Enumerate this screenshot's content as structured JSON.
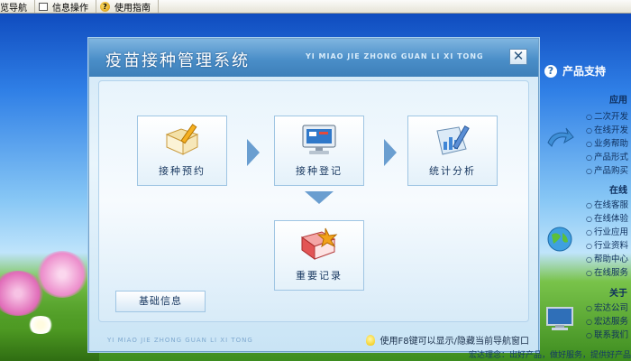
{
  "menubar": {
    "items": [
      {
        "label": "览导航",
        "icon": "none"
      },
      {
        "label": "信息操作",
        "icon": "page-icon"
      },
      {
        "label": "使用指南",
        "icon": "help-icon"
      }
    ]
  },
  "dialog": {
    "title": "疫苗接种管理系统",
    "title_pinyin": "YI MIAO JIE ZHONG GUAN LI XI TONG",
    "close_label": "✕",
    "features": [
      {
        "label": "接种预约",
        "icon": "notebook-pencil-icon"
      },
      {
        "label": "接种登记",
        "icon": "computer-monitor-icon"
      },
      {
        "label": "统计分析",
        "icon": "chart-pen-icon"
      },
      {
        "label": "重要记录",
        "icon": "book-leaf-icon"
      }
    ],
    "basic_info_label": "基础信息",
    "footer_pinyin": "YI MIAO JIE ZHONG GUAN LI XI TONG",
    "footer_tip": "使用F8键可以显示/隐藏当前导航窗口"
  },
  "sidebar": {
    "header": "产品支持",
    "sections": [
      {
        "title": "应用",
        "items": [
          "二次开发",
          "在线开发",
          "业务帮助",
          "产品形式",
          "产品购买"
        ]
      },
      {
        "title": "在线",
        "items": [
          "在线客服",
          "在线体验",
          "行业应用",
          "行业资料",
          "帮助中心",
          "在线服务"
        ]
      },
      {
        "title": "关于",
        "items": [
          "宏达公司",
          "宏达服务",
          "联系我们"
        ]
      }
    ],
    "bottom_text": "宏达理念：出好产品，做好服务，提供好产品"
  }
}
